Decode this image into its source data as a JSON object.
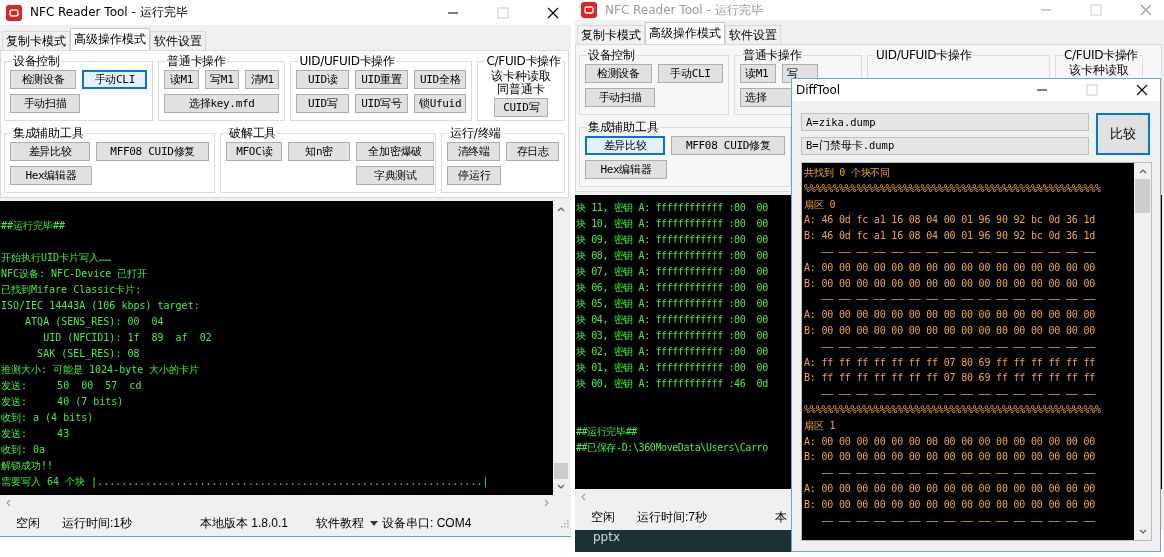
{
  "windows": [
    {
      "title": "NFC Reader Tool - 运行完毕",
      "active": true,
      "tabs": [
        {
          "label": "复制卡模式",
          "selected": false
        },
        {
          "label": "高级操作模式",
          "selected": true
        },
        {
          "label": "软件设置",
          "selected": false
        }
      ],
      "group_rows": [
        [
          {
            "kind": "device",
            "title": "设备控制",
            "rows": [
              [
                {
                  "label": "检测设备",
                  "focused": false
                },
                {
                  "label": "手动CLI",
                  "focused": true
                }
              ],
              [
                {
                  "label": "手动扫描",
                  "focused": false
                }
              ]
            ]
          },
          {
            "kind": "normal",
            "title": "普通卡操作",
            "rows": [
              [
                {
                  "label": "读M1",
                  "focused": false
                },
                {
                  "label": "写M1",
                  "focused": false
                },
                {
                  "label": "清M1",
                  "focused": false
                }
              ],
              [
                {
                  "label": "选择key.mfd",
                  "focused": false
                }
              ]
            ]
          },
          {
            "kind": "uid",
            "title": "UID/UFUID卡操作",
            "rows": [
              [
                {
                  "label": "UID读",
                  "focused": false
                },
                {
                  "label": "UID重置",
                  "focused": false
                },
                {
                  "label": "UID全格",
                  "focused": false
                }
              ],
              [
                {
                  "label": "UID写",
                  "focused": false
                },
                {
                  "label": "UID写号",
                  "focused": false
                },
                {
                  "label": "锁Ufuid",
                  "focused": false
                }
              ]
            ]
          },
          {
            "kind": "cfuid",
            "title": "C/FUID卡操作",
            "note": "该卡种读取同普通卡",
            "rows": [
              [
                {
                  "label": "CUID写",
                  "focused": false
                }
              ]
            ]
          }
        ],
        [
          {
            "kind": "tools",
            "title": "集成辅助工具",
            "rows": [
              [
                {
                  "label": "差异比较",
                  "focused": false
                },
                {
                  "label": "MFF08 CUID修复",
                  "focused": false
                }
              ],
              [
                {
                  "label": "Hex编辑器",
                  "focused": false
                }
              ]
            ]
          },
          {
            "kind": "crack",
            "title": "破解工具",
            "rows": [
              [
                {
                  "label": "MFOC读",
                  "focused": false
                },
                {
                  "label": "知n密",
                  "focused": false
                },
                {
                  "label": "全加密爆破",
                  "focused": false
                }
              ],
              [
                "",
                "",
                {
                  "label": "字典测试",
                  "focused": false
                }
              ]
            ]
          },
          {
            "kind": "run",
            "title": "运行/终端",
            "rows": [
              [
                {
                  "label": "清终端",
                  "focused": false
                },
                {
                  "label": "存日志",
                  "focused": false
                }
              ],
              [
                {
                  "label": "停运行",
                  "focused": false
                }
              ]
            ]
          }
        ]
      ],
      "console_blocks": [
        [
          "##运行完毕##"
        ],
        [
          "开始执行UID卡片写入……",
          "NFC设备: NFC-Device 已打开",
          "已找到Mifare Classic卡片:",
          "ISO/IEC 14443A (106 kbps) target:",
          "    ATQA (SENS_RES): 00  04",
          "       UID (NFCID1): 1f  89  af  02",
          "      SAK (SEL_RES): 08",
          "推测大小: 可能是 1024-byte 大小的卡片",
          "发送:     50  00  57  cd",
          "发送:     40 (7 bits)",
          "收到: a (4 bits)",
          "发送:     43",
          "收到: 0a",
          "解锁成功!!",
          "需要写入 64 个块 |................................................................|"
        ]
      ],
      "status": {
        "state": "空闲",
        "runtime": "运行时间:1秒",
        "version": "本地版本 1.8.0.1",
        "tutorial": "软件教程",
        "port": "设备串口: COM4"
      }
    },
    {
      "title": "NFC Reader Tool - 运行完毕",
      "active": false,
      "tabs": [
        {
          "label": "复制卡模式",
          "selected": false
        },
        {
          "label": "高级操作模式",
          "selected": true
        },
        {
          "label": "软件设置",
          "selected": false
        }
      ],
      "group_rows": [
        [
          {
            "kind": "device",
            "title": "设备控制",
            "rows": [
              [
                {
                  "label": "检测设备",
                  "focused": false
                },
                {
                  "label": "手动CLI",
                  "focused": false
                }
              ],
              [
                {
                  "label": "手动扫描",
                  "focused": false
                }
              ]
            ]
          },
          {
            "kind": "normal-partial",
            "title": "普通卡操作",
            "rows": [
              [
                {
                  "label": "读M1",
                  "focused": false
                },
                {
                  "label": "写",
                  "focused": false
                }
              ],
              [
                {
                  "label": "选择",
                  "focused": false
                }
              ]
            ]
          },
          {
            "kind": "uid",
            "title": "UID/UFUID卡操作"
          },
          {
            "kind": "cfuid",
            "title": "C/FUID卡操作",
            "note": "该卡种读取"
          }
        ],
        [
          {
            "kind": "tools",
            "title": "集成辅助工具",
            "rows": [
              [
                {
                  "label": "差异比较",
                  "focused": true
                },
                {
                  "label": "MFF08 CUID修复",
                  "focused": false
                }
              ],
              [
                {
                  "label": "Hex编辑器",
                  "focused": false
                }
              ]
            ]
          }
        ]
      ],
      "console_blocks": [
        [
          "块 11, 密钥 A: ffffffffffff :00  00",
          "块 10, 密钥 A: ffffffffffff :00  00",
          "块 09, 密钥 A: ffffffffffff :00  00",
          "块 08, 密钥 A: ffffffffffff :00  00",
          "块 07, 密钥 A: ffffffffffff :00  00",
          "块 06, 密钥 A: ffffffffffff :00  00",
          "块 05, 密钥 A: ffffffffffff :00  00",
          "块 04, 密钥 A: ffffffffffff :00  00",
          "块 03, 密钥 A: ffffffffffff :00  00",
          "块 02, 密钥 A: ffffffffffff :00  00",
          "块 01, 密钥 A: ffffffffffff :00  00",
          "块 00, 密钥 A: ffffffffffff :46  0d"
        ],
        [
          "##运行完毕##",
          "##已保存-D:\\360MoveData\\Users\\Carro"
        ]
      ],
      "status": {
        "state": "空闲",
        "runtime": "运行时间:7秒",
        "version": "本"
      }
    }
  ],
  "desktop": {
    "file_name": "pptx"
  },
  "diff_tool": {
    "title": "DiffTool",
    "file_a": "A=zika.dump",
    "file_b": "B=门禁母卡.dump",
    "compare_button": "比较",
    "output": [
      "共找到 0 个块不同",
      "%%%%%%%%%%%%%%%%%%%%%%%%%%%%%%%%%%%%%%%%%%%%%%%%%%%",
      "扇区 0",
      "A: 46 0d fc a1 16 08 04 00 01 96 90 92 bc 0d 36 1d",
      "B: 46 0d fc a1 16 08 04 00 01 96 90 92 bc 0d 36 1d",
      "   —— —— —— —— —— —— —— —— —— —— —— —— —— —— —— ——",
      "A: 00 00 00 00 00 00 00 00 00 00 00 00 00 00 00 00",
      "B: 00 00 00 00 00 00 00 00 00 00 00 00 00 00 00 00",
      "   —— —— —— —— —— —— —— —— —— —— —— —— —— —— —— ——",
      "A: 00 00 00 00 00 00 00 00 00 00 00 00 00 00 00 00",
      "B: 00 00 00 00 00 00 00 00 00 00 00 00 00 00 00 00",
      "   —— —— —— —— —— —— —— —— —— —— —— —— —— —— —— ——",
      "A: ff ff ff ff ff ff ff 07 80 69 ff ff ff ff ff ff",
      "B: ff ff ff ff ff ff ff 07 80 69 ff ff ff ff ff ff",
      "   —— —— —— —— —— —— —— —— —— —— —— —— —— —— —— ——",
      "%%%%%%%%%%%%%%%%%%%%%%%%%%%%%%%%%%%%%%%%%%%%%%%%%%%",
      "扇区 1",
      "A: 00 00 00 00 00 00 00 00 00 00 00 00 00 00 00 00",
      "B: 00 00 00 00 00 00 00 00 00 00 00 00 00 00 00 00",
      "   —— —— —— —— —— —— —— —— —— —— —— —— —— —— —— ——",
      "A: 00 00 00 00 00 00 00 00 00 00 00 00 00 00 00 00",
      "B: 00 00 00 00 00 00 00 00 00 00 00 00 00 00 00 00",
      "   —— —— —— —— —— —— —— —— —— —— —— —— —— —— —— ——"
    ]
  }
}
